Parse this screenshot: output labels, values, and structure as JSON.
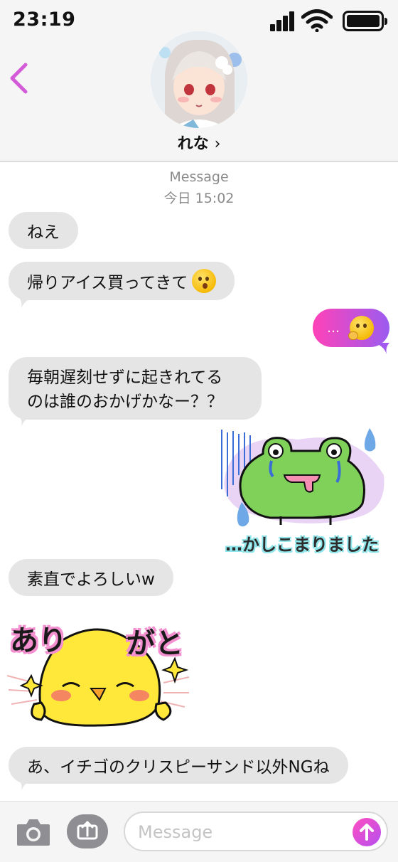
{
  "status_bar": {
    "time": "23:19"
  },
  "header": {
    "contact_name": "れな",
    "contact_chevron": "›"
  },
  "thread": {
    "label": "Message",
    "timestamp": "今日 15:02"
  },
  "messages": [
    {
      "from": "contact",
      "text": "ねえ"
    },
    {
      "from": "contact",
      "text": "帰りアイス買ってきて",
      "emoji": "kissing-face-emoji"
    },
    {
      "from": "me",
      "text": "…",
      "emoji": "thinking-face-emoji"
    },
    {
      "from": "contact",
      "lines": [
        "毎朝遅刻せずに起きれてる",
        "のは誰のおかげかなー？？"
      ]
    },
    {
      "from": "me",
      "type": "sticker",
      "caption": "…かしこまりました"
    },
    {
      "from": "contact",
      "text": "素直でよろしいw"
    },
    {
      "from": "contact",
      "type": "sticker",
      "caption_left": "あり",
      "caption_right": "がと"
    },
    {
      "from": "contact",
      "text": "あ、イチゴのクリスピーサンド以外NGね"
    }
  ],
  "composer": {
    "placeholder": "Message"
  },
  "colors": {
    "accent_pink": "#ff42b8",
    "accent_purple": "#9b5cf0",
    "back_chevron": "#d35bd8",
    "bubble_gray": "#e5e5e5"
  }
}
